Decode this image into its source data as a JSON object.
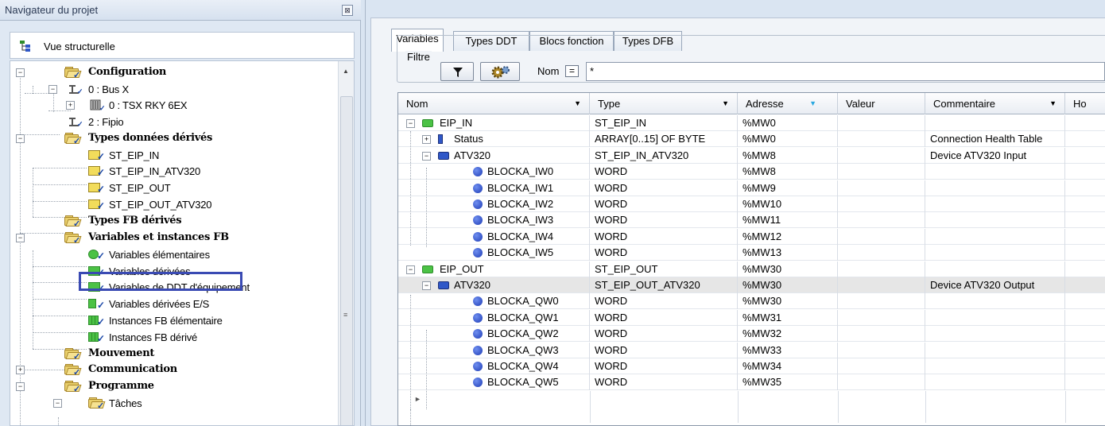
{
  "navigator": {
    "title": "Navigateur du projet",
    "close_glyph": "⊠",
    "structural_view": "Vue structurelle",
    "tree": [
      {
        "label": "Configuration",
        "bold": true
      },
      {
        "label": "0 : Bus X"
      },
      {
        "label": "0 : TSX RKY 6EX"
      },
      {
        "label": "2 : Fipio"
      },
      {
        "label": "Types données dérivés",
        "bold": true
      },
      {
        "label": "ST_EIP_IN"
      },
      {
        "label": "ST_EIP_IN_ATV320"
      },
      {
        "label": "ST_EIP_OUT"
      },
      {
        "label": "ST_EIP_OUT_ATV320"
      },
      {
        "label": "Types FB dérivés",
        "bold": true
      },
      {
        "label": "Variables et instances FB",
        "bold": true
      },
      {
        "label": "Variables élémentaires"
      },
      {
        "label": "Variables dérivées",
        "highlighted": true
      },
      {
        "label": "Variables de DDT d'équipement"
      },
      {
        "label": "Variables dérivées E/S"
      },
      {
        "label": "Instances FB élémentaire"
      },
      {
        "label": "Instances FB dérivé"
      },
      {
        "label": "Mouvement",
        "bold": true
      },
      {
        "label": "Communication",
        "bold": true
      },
      {
        "label": "Programme",
        "bold": true
      },
      {
        "label": "Tâches"
      }
    ]
  },
  "editor": {
    "tabs": [
      "Variables",
      "Types DDT",
      "Blocs fonction",
      "Types DFB"
    ],
    "active_tab": "Variables",
    "filter": {
      "group_label": "Filtre",
      "name_label": "Nom",
      "eq_glyph": "=",
      "name_value": "*"
    },
    "columns": [
      "Nom",
      "Type",
      "Adresse",
      "Valeur",
      "Commentaire",
      "Ho"
    ],
    "rows": [
      {
        "name": "EIP_IN",
        "type": "ST_EIP_IN",
        "address": "%MW0",
        "value": "",
        "comment": ""
      },
      {
        "name": "Status",
        "type": "ARRAY[0..15] OF BYTE",
        "address": "%MW0",
        "value": "",
        "comment": "Connection Health Table"
      },
      {
        "name": "ATV320",
        "type": "ST_EIP_IN_ATV320",
        "address": "%MW8",
        "value": "",
        "comment": "Device ATV320 Input"
      },
      {
        "name": "BLOCKA_IW0",
        "type": "WORD",
        "address": "%MW8",
        "value": "",
        "comment": ""
      },
      {
        "name": "BLOCKA_IW1",
        "type": "WORD",
        "address": "%MW9",
        "value": "",
        "comment": ""
      },
      {
        "name": "BLOCKA_IW2",
        "type": "WORD",
        "address": "%MW10",
        "value": "",
        "comment": ""
      },
      {
        "name": "BLOCKA_IW3",
        "type": "WORD",
        "address": "%MW11",
        "value": "",
        "comment": ""
      },
      {
        "name": "BLOCKA_IW4",
        "type": "WORD",
        "address": "%MW12",
        "value": "",
        "comment": ""
      },
      {
        "name": "BLOCKA_IW5",
        "type": "WORD",
        "address": "%MW13",
        "value": "",
        "comment": ""
      },
      {
        "name": "EIP_OUT",
        "type": "ST_EIP_OUT",
        "address": "%MW30",
        "value": "",
        "comment": ""
      },
      {
        "name": "ATV320",
        "type": "ST_EIP_OUT_ATV320",
        "address": "%MW30",
        "value": "",
        "comment": "Device ATV320 Output"
      },
      {
        "name": "BLOCKA_QW0",
        "type": "WORD",
        "address": "%MW30",
        "value": "",
        "comment": ""
      },
      {
        "name": "BLOCKA_QW1",
        "type": "WORD",
        "address": "%MW31",
        "value": "",
        "comment": ""
      },
      {
        "name": "BLOCKA_QW2",
        "type": "WORD",
        "address": "%MW32",
        "value": "",
        "comment": ""
      },
      {
        "name": "BLOCKA_QW3",
        "type": "WORD",
        "address": "%MW33",
        "value": "",
        "comment": ""
      },
      {
        "name": "BLOCKA_QW4",
        "type": "WORD",
        "address": "%MW34",
        "value": "",
        "comment": ""
      },
      {
        "name": "BLOCKA_QW5",
        "type": "WORD",
        "address": "%MW35",
        "value": "",
        "comment": ""
      }
    ],
    "new_row_glyph": "►"
  },
  "colors": {
    "highlight_box": "#3a4ab3",
    "selected_row": "#e6e6e6",
    "panel_bg": "#dae5f2"
  }
}
